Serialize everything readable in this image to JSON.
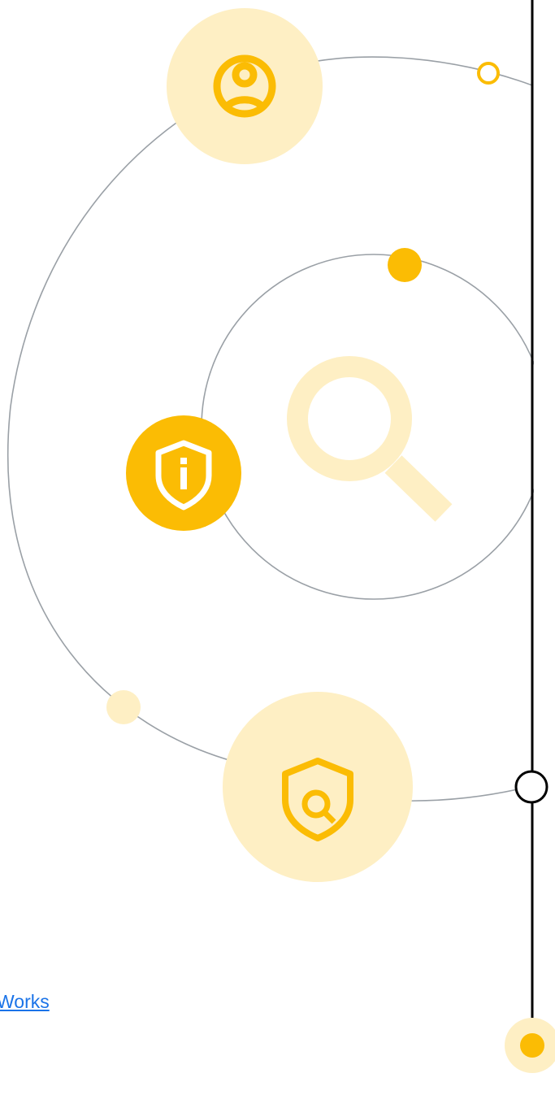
{
  "link": {
    "text": "Works"
  },
  "icons": {
    "top": "user-icon",
    "middle_left": "shield-info-icon",
    "center": "magnifier-icon",
    "bottom": "shield-search-icon"
  },
  "colors": {
    "accent": "#fbbc04",
    "accent_light": "#feefc4",
    "accent_pale": "#feefc4",
    "line": "#9aa0a6",
    "timeline": "#000000",
    "link": "#1a73e8"
  }
}
